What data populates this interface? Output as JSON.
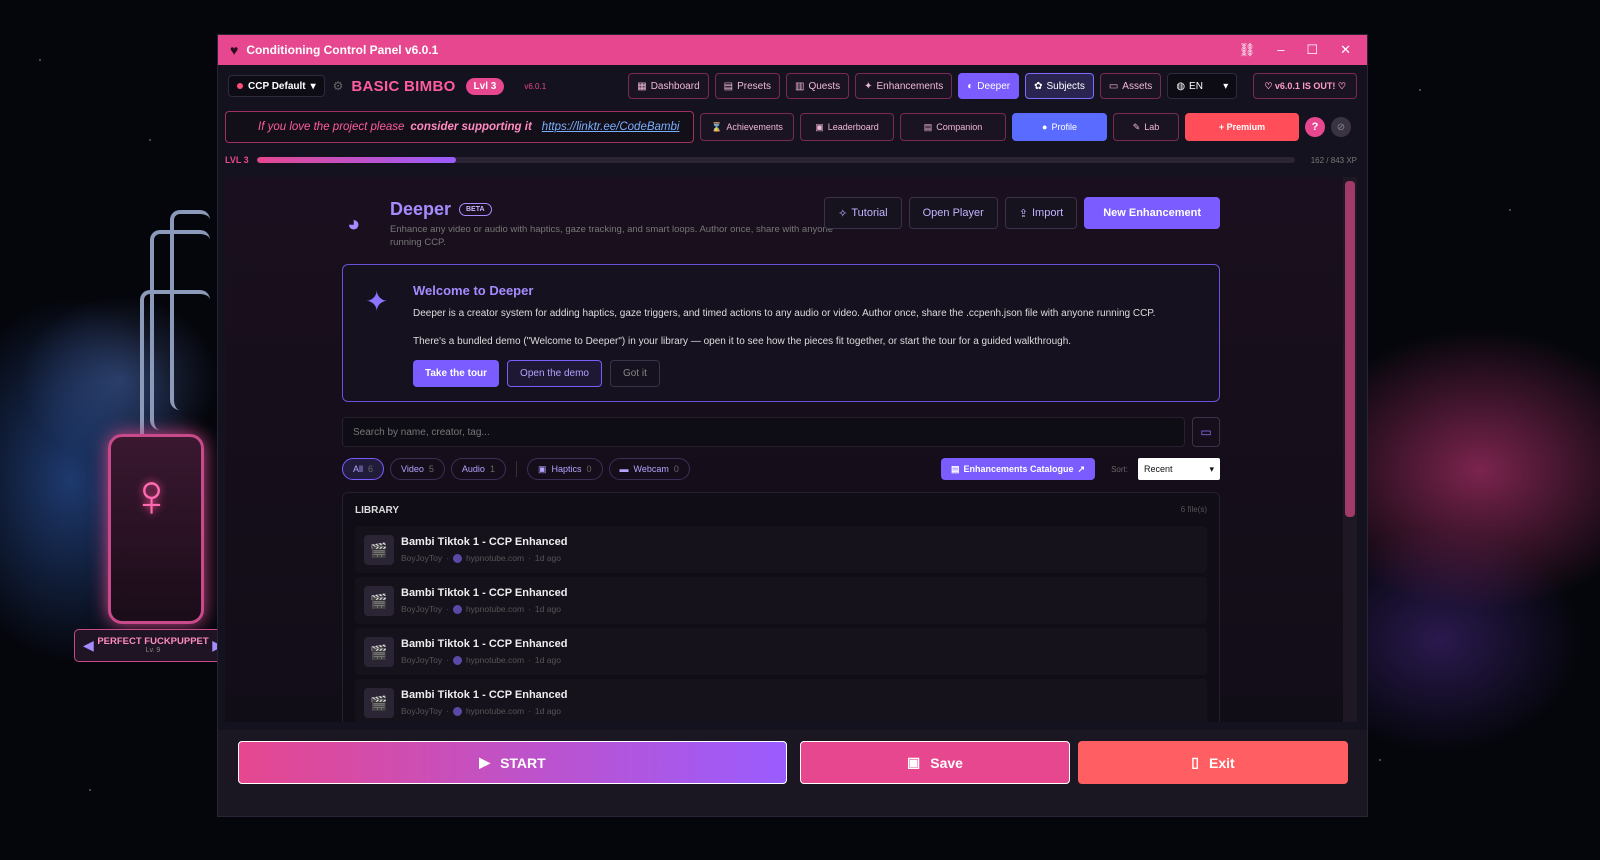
{
  "window": {
    "title": "Conditioning Control Panel v6.0.1"
  },
  "header": {
    "preset_label": "CCP Default",
    "rank": "BASIC BIMBO",
    "level_badge": "Lvl 3",
    "version": "v6.0.1",
    "nav": [
      "Dashboard",
      "Presets",
      "Quests",
      "Enhancements",
      "Deeper",
      "Subjects",
      "Assets"
    ],
    "language": "EN",
    "update_label": "v6.0.1 IS OUT!"
  },
  "support": {
    "prefix": "If you love the project please",
    "bold": "consider supporting it",
    "link": "https://linktr.ee/CodeBambi"
  },
  "nav2": [
    "Achievements",
    "Leaderboard",
    "Companion",
    "Profile",
    "Lab",
    "+ Premium"
  ],
  "xp": {
    "level_label": "LVL 3",
    "text": "162 / 843 XP",
    "fraction": 0.192
  },
  "deeper": {
    "title": "Deeper",
    "badge": "BETA",
    "subtitle": "Enhance any video or audio with haptics, gaze tracking, and smart loops. Author once, share with anyone running CCP.",
    "buttons": {
      "tutorial": "Tutorial",
      "open_player": "Open Player",
      "import": "Import",
      "new": "New Enhancement"
    }
  },
  "welcome": {
    "title": "Welcome to Deeper",
    "p1": "Deeper is a creator system for adding haptics, gaze triggers, and timed actions to any audio or video. Author once, share the .ccpenh.json file with anyone running CCP.",
    "p2": "There's a bundled demo (\"Welcome to Deeper\") in your library — open it to see how the pieces fit together, or start the tour for a guided walkthrough.",
    "btn_tour": "Take the tour",
    "btn_demo": "Open the demo",
    "btn_got": "Got it"
  },
  "search": {
    "placeholder": "Search by name, creator, tag..."
  },
  "filters": [
    {
      "label": "All",
      "count": "6"
    },
    {
      "label": "Video",
      "count": "5"
    },
    {
      "label": "Audio",
      "count": "1"
    },
    {
      "label": "Haptics",
      "count": "0"
    },
    {
      "label": "Webcam",
      "count": "0"
    }
  ],
  "catalog_label": "Enhancements Catalogue",
  "sort": {
    "label": "Sort:",
    "value": "Recent"
  },
  "library": {
    "title": "LIBRARY",
    "count": "6 file(s)",
    "items": [
      {
        "name": "Bambi Tiktok 1 - CCP Enhanced",
        "creator": "BoyJoyToy",
        "source": "hypnotube.com",
        "age": "1d ago"
      },
      {
        "name": "Bambi Tiktok 1 - CCP Enhanced",
        "creator": "BoyJoyToy",
        "source": "hypnotube.com",
        "age": "1d ago"
      },
      {
        "name": "Bambi Tiktok 1 - CCP Enhanced",
        "creator": "BoyJoyToy",
        "source": "hypnotube.com",
        "age": "1d ago"
      },
      {
        "name": "Bambi Tiktok 1 - CCP Enhanced",
        "creator": "BoyJoyToy",
        "source": "hypnotube.com",
        "age": "1d ago"
      }
    ]
  },
  "actions": {
    "start": "START",
    "save": "Save",
    "exit": "Exit"
  },
  "companion": {
    "name": "PERFECT FUCKPUPPET",
    "level": "Lv. 9"
  },
  "colors": {
    "accent_pink": "#e6478f",
    "accent_purple": "#7a5cff",
    "exit_red": "#ff5e62"
  }
}
